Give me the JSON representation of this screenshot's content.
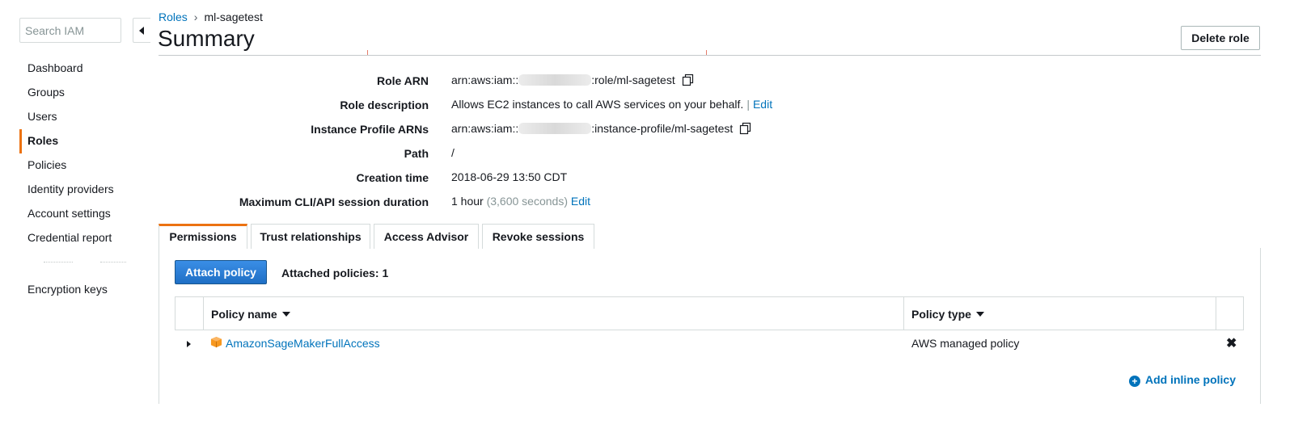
{
  "sidebar": {
    "search_placeholder": "Search IAM",
    "items": [
      {
        "label": "Dashboard"
      },
      {
        "label": "Groups"
      },
      {
        "label": "Users"
      },
      {
        "label": "Roles",
        "active": true
      },
      {
        "label": "Policies"
      },
      {
        "label": "Identity providers"
      },
      {
        "label": "Account settings"
      },
      {
        "label": "Credential report"
      }
    ],
    "encryption_keys": "Encryption keys"
  },
  "breadcrumb": {
    "parent": "Roles",
    "current": "ml-sagetest"
  },
  "header": {
    "title": "Summary",
    "delete_label": "Delete role"
  },
  "summary": {
    "role_arn": {
      "label": "Role ARN",
      "prefix": "arn:aws:iam::",
      "suffix": ":role/ml-sagetest"
    },
    "role_description": {
      "label": "Role description",
      "value": "Allows EC2 instances to call AWS services on your behalf.",
      "edit": "Edit"
    },
    "instance_profile": {
      "label": "Instance Profile ARNs",
      "prefix": "arn:aws:iam::",
      "suffix": ":instance-profile/ml-sagetest"
    },
    "path": {
      "label": "Path",
      "value": "/"
    },
    "creation_time": {
      "label": "Creation time",
      "value": "2018-06-29 13:50 CDT"
    },
    "session_duration": {
      "label": "Maximum CLI/API session duration",
      "value": "1 hour",
      "seconds": "(3,600 seconds)",
      "edit": "Edit"
    }
  },
  "tabs": [
    {
      "label": "Permissions",
      "active": true
    },
    {
      "label": "Trust relationships"
    },
    {
      "label": "Access Advisor"
    },
    {
      "label": "Revoke sessions"
    }
  ],
  "permissions": {
    "attach_label": "Attach policy",
    "attached_count": "Attached policies: 1",
    "columns": {
      "policy_name": "Policy name",
      "policy_type": "Policy type"
    },
    "rows": [
      {
        "name": "AmazonSageMakerFullAccess",
        "type": "AWS managed policy",
        "icon": "aws-managed-policy-icon"
      }
    ],
    "add_inline_label": "Add inline policy"
  },
  "colors": {
    "accent": "#ec7211",
    "link": "#0073bb",
    "primary_button": "#1f6fc5"
  }
}
